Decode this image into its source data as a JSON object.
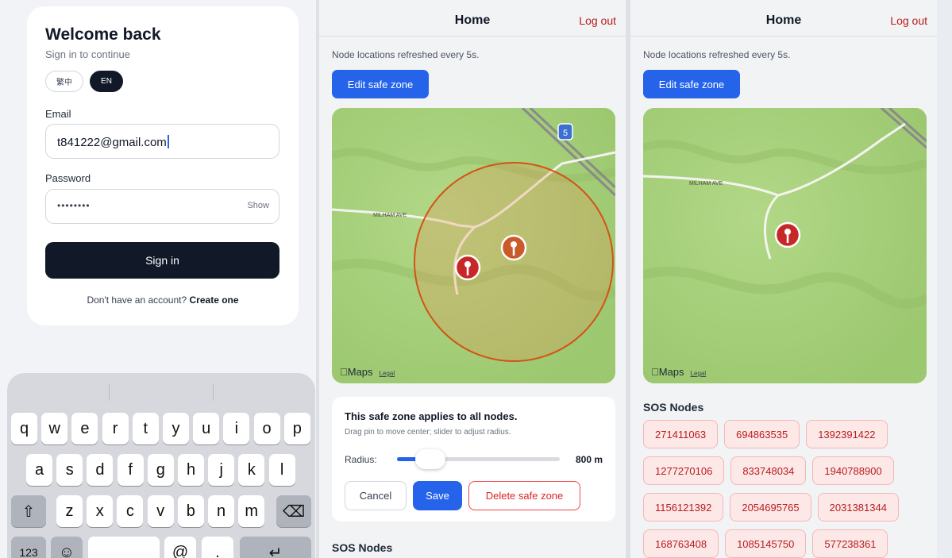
{
  "login": {
    "title": "Welcome back",
    "subtitle": "Sign in to continue",
    "lang_zh": "繁中",
    "lang_en": "EN",
    "email_label": "Email",
    "email_value": "t841222@gmail.com",
    "password_label": "Password",
    "password_mask": "••••••••",
    "show_label": "Show",
    "signin_label": "Sign in",
    "signup_prompt": "Don't have an account?",
    "signup_link": "Create one"
  },
  "keyboard": {
    "row1": [
      "q",
      "w",
      "e",
      "r",
      "t",
      "y",
      "u",
      "i",
      "o",
      "p"
    ],
    "row2": [
      "a",
      "s",
      "d",
      "f",
      "g",
      "h",
      "j",
      "k",
      "l"
    ],
    "row3": [
      "z",
      "x",
      "c",
      "v",
      "b",
      "n",
      "m"
    ],
    "shift": "⇧",
    "backspace": "⌫",
    "numbers": "123",
    "emoji": "☺",
    "at": "@",
    "dot": ".",
    "return": "↵"
  },
  "home": {
    "title": "Home",
    "logout": "Log out",
    "refresh_note": "Node locations refreshed every 5s.",
    "edit_zone": "Edit safe zone",
    "maps_brand": "Maps",
    "maps_legal": "Legal",
    "road_label_1": "MILHAM AVE",
    "road_label_2": "MILHAM AVE",
    "shield": "5",
    "safezone": {
      "title": "This safe zone applies to all nodes.",
      "hint": "Drag pin to move center; slider to adjust radius.",
      "radius_label": "Radius:",
      "radius_value": "800 m",
      "radius_fraction": 0.15,
      "cancel": "Cancel",
      "save": "Save",
      "delete": "Delete safe zone"
    },
    "sos_title": "SOS Nodes",
    "sos_nodes": [
      "271411063",
      "694863535",
      "1392391422",
      "1277270106",
      "833748034",
      "1940788900",
      "1156121392",
      "2054695765",
      "2031381344",
      "168763408",
      "1085145750",
      "577238361"
    ]
  },
  "colors": {
    "accent": "#2563eb",
    "danger": "#b91c1c",
    "dark": "#111827",
    "map_green": "#a9d07c"
  }
}
